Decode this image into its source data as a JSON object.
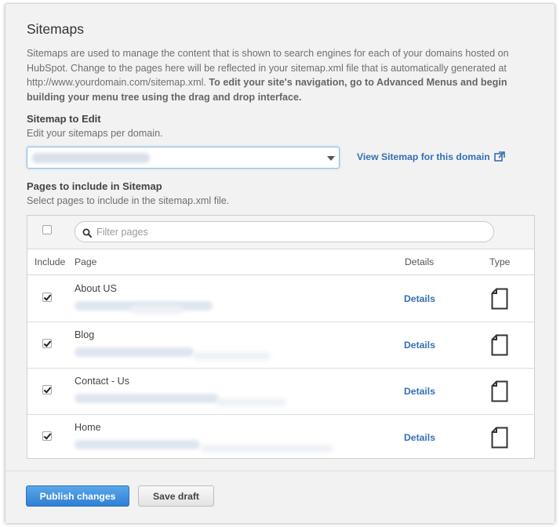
{
  "header": {
    "title": "Sitemaps",
    "intro_text": "Sitemaps are used to manage the content that is shown to search engines for each of your domains hosted on HubSpot. Change to the pages here will be reflected in your sitemap.xml file that is automatically generated at http://www.yourdomain.com/sitemap.xml.",
    "intro_bold": "To edit your site's navigation, go to Advanced Menus and begin building your menu tree using the drag and drop interface."
  },
  "sitemap_to_edit": {
    "label": "Sitemap to Edit",
    "help": "Edit your sitemaps per domain.",
    "view_link": "View Sitemap for this domain"
  },
  "pages_section": {
    "label": "Pages to include in Sitemap",
    "help": "Select pages to include in the sitemap.xml file.",
    "filter_placeholder": "Filter pages",
    "columns": {
      "include": "Include",
      "page": "Page",
      "details": "Details",
      "type": "Type"
    },
    "rows": [
      {
        "page": "About US",
        "details": "Details",
        "included": true,
        "type_icon": "page-icon"
      },
      {
        "page": "Blog",
        "details": "Details",
        "included": true,
        "type_icon": "page-icon"
      },
      {
        "page": "Contact - Us",
        "details": "Details",
        "included": true,
        "type_icon": "page-icon"
      },
      {
        "page": "Home",
        "details": "Details",
        "included": true,
        "type_icon": "page-icon"
      }
    ]
  },
  "footer": {
    "publish": "Publish changes",
    "save_draft": "Save draft"
  },
  "colors": {
    "link": "#3470b4",
    "primary_button": "#3d8fdf",
    "background": "#f2f2f2"
  }
}
